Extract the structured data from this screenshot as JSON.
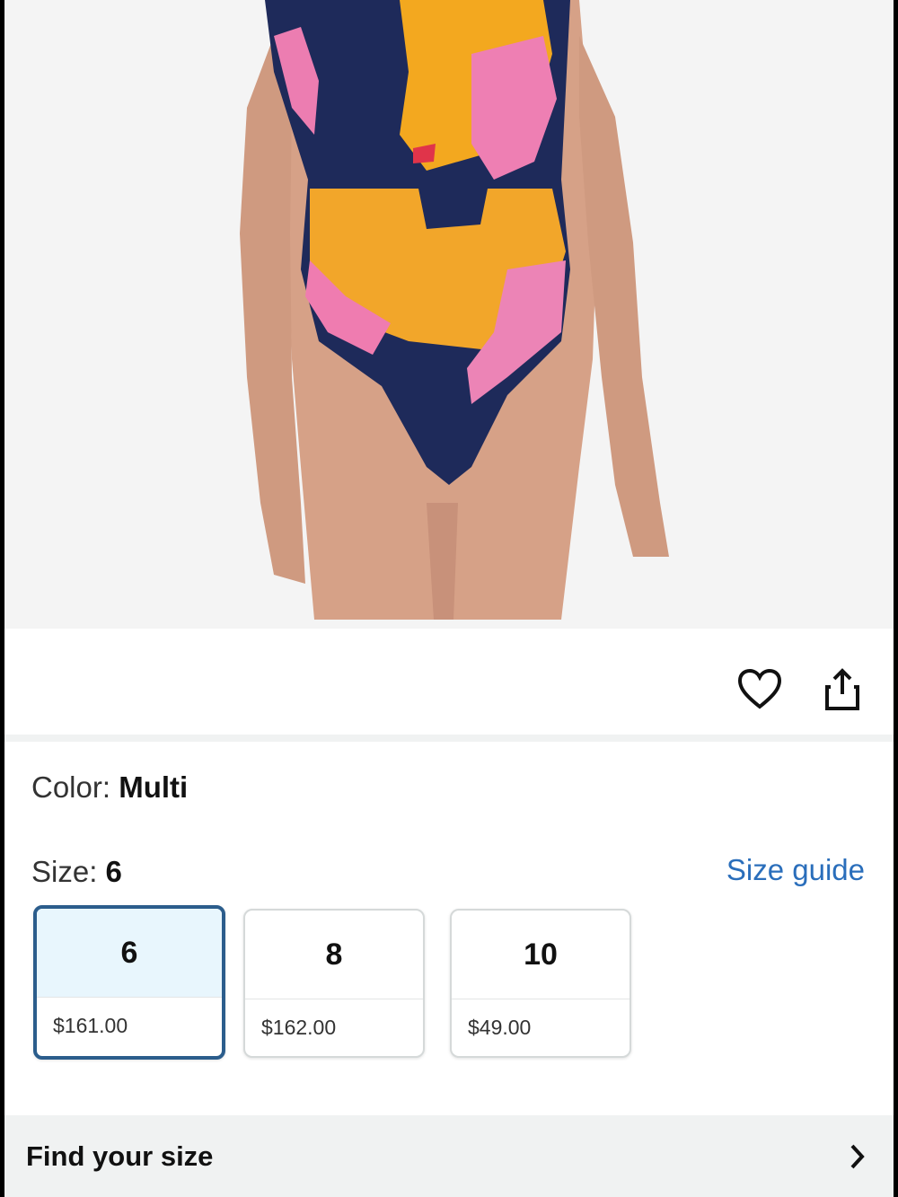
{
  "product": {
    "color_label": "Color: ",
    "color_value": "Multi",
    "size_label": "Size: ",
    "size_value": "6",
    "size_guide_label": "Size guide"
  },
  "sizes": [
    {
      "size": "6",
      "price": "$161.00",
      "selected": true
    },
    {
      "size": "8",
      "price": "$162.00",
      "selected": false
    },
    {
      "size": "10",
      "price": "$49.00",
      "selected": false
    }
  ],
  "find_size": {
    "label": "Find your size"
  },
  "icons": {
    "wishlist": "heart-icon",
    "share": "share-icon",
    "chevron": "chevron-right-icon"
  },
  "colors": {
    "link": "#2a6ebb",
    "selected_border": "#2b5d8c",
    "selected_fill": "#e8f6fd"
  }
}
